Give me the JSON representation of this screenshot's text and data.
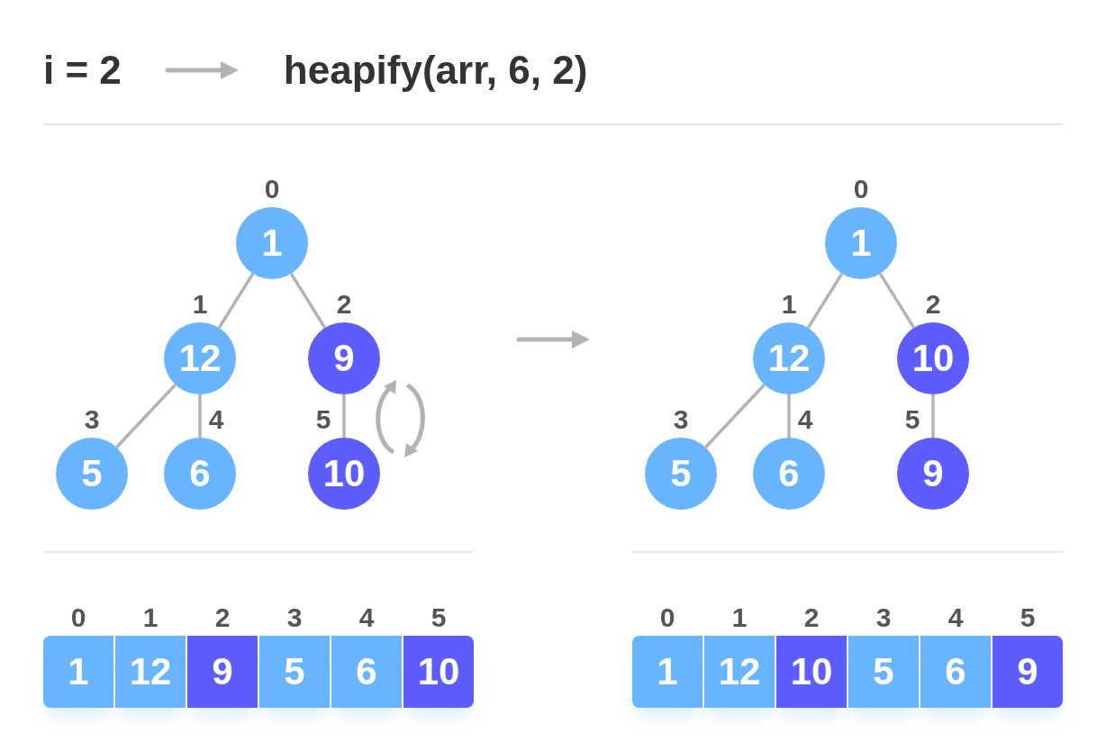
{
  "header": {
    "step": "i = 2",
    "call": "heapify(arr, 6, 2)"
  },
  "panels": [
    {
      "swap_marker": true,
      "tree": {
        "index": "0",
        "value": "1",
        "highlighted": false,
        "children": [
          {
            "index": "1",
            "value": "12",
            "highlighted": false,
            "children": [
              {
                "index": "3",
                "value": "5",
                "highlighted": false
              },
              {
                "index": "4",
                "value": "6",
                "highlighted": false
              }
            ]
          },
          {
            "index": "2",
            "value": "9",
            "highlighted": true,
            "children": [
              {
                "index": "5",
                "value": "10",
                "highlighted": true
              }
            ]
          }
        ]
      },
      "array": [
        {
          "index": "0",
          "value": "1",
          "highlighted": false
        },
        {
          "index": "1",
          "value": "12",
          "highlighted": false
        },
        {
          "index": "2",
          "value": "9",
          "highlighted": true
        },
        {
          "index": "3",
          "value": "5",
          "highlighted": false
        },
        {
          "index": "4",
          "value": "6",
          "highlighted": false
        },
        {
          "index": "5",
          "value": "10",
          "highlighted": true
        }
      ]
    },
    {
      "swap_marker": false,
      "tree": {
        "index": "0",
        "value": "1",
        "highlighted": false,
        "children": [
          {
            "index": "1",
            "value": "12",
            "highlighted": false,
            "children": [
              {
                "index": "3",
                "value": "5",
                "highlighted": false
              },
              {
                "index": "4",
                "value": "6",
                "highlighted": false
              }
            ]
          },
          {
            "index": "2",
            "value": "10",
            "highlighted": true,
            "children": [
              {
                "index": "5",
                "value": "9",
                "highlighted": true
              }
            ]
          }
        ]
      },
      "array": [
        {
          "index": "0",
          "value": "1",
          "highlighted": false
        },
        {
          "index": "1",
          "value": "12",
          "highlighted": false
        },
        {
          "index": "2",
          "value": "10",
          "highlighted": true
        },
        {
          "index": "3",
          "value": "5",
          "highlighted": false
        },
        {
          "index": "4",
          "value": "6",
          "highlighted": false
        },
        {
          "index": "5",
          "value": "9",
          "highlighted": true
        }
      ]
    }
  ]
}
